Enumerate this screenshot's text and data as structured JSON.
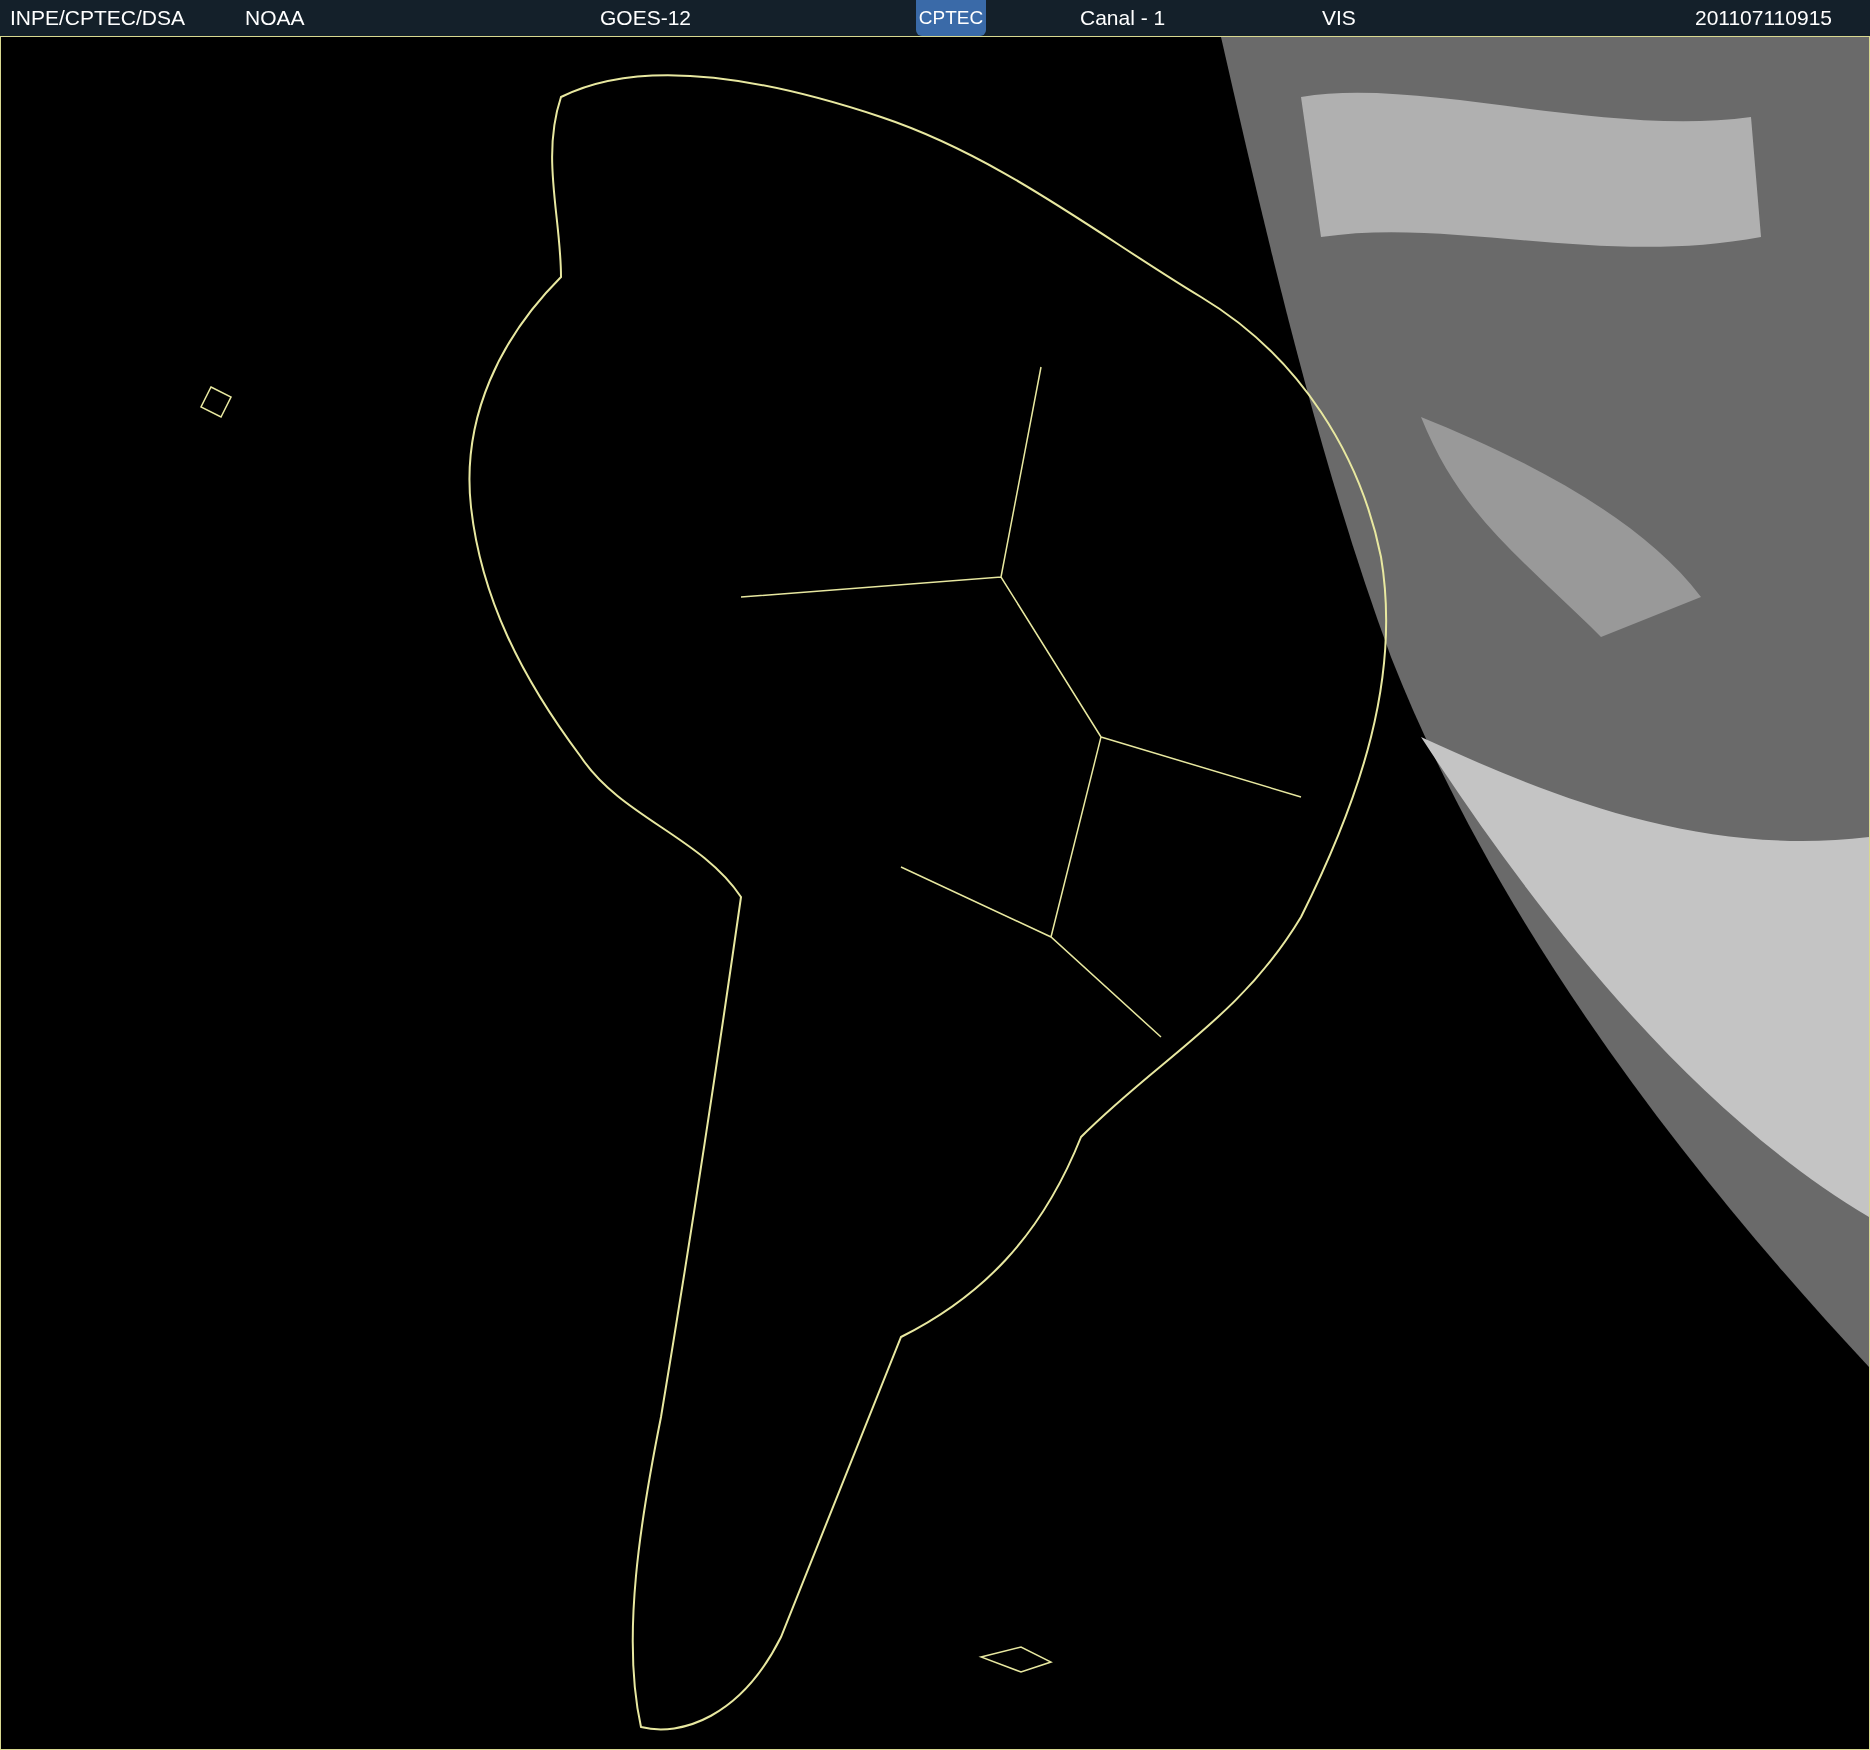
{
  "header": {
    "source": "INPE/CPTEC/DSA",
    "agency": "NOAA",
    "satellite": "GOES-12",
    "logo": "CPTEC",
    "channel": "Canal - 1",
    "band": "VIS",
    "timestamp": "201107110915"
  }
}
